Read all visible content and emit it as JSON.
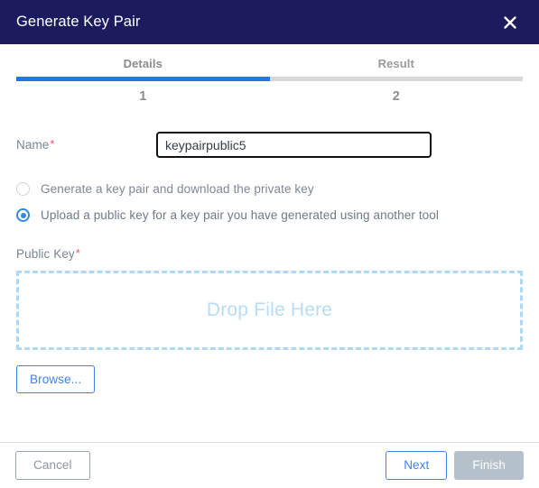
{
  "dialog": {
    "title": "Generate Key Pair",
    "close_icon": "close-icon"
  },
  "stepper": {
    "steps": [
      {
        "label": "Details",
        "number": "1",
        "active": true
      },
      {
        "label": "Result",
        "number": "2",
        "active": false
      }
    ]
  },
  "form": {
    "name_label": "Name",
    "name_required_mark": "*",
    "name_value": "keypairpublic5",
    "name_placeholder": "",
    "options": [
      {
        "label": "Generate a key pair and download the private key",
        "selected": false
      },
      {
        "label": "Upload a public key for a key pair you have generated using another tool",
        "selected": true
      }
    ],
    "public_key_label": "Public Key",
    "public_key_required_mark": "*",
    "dropzone_text": "Drop File Here",
    "browse_label": "Browse..."
  },
  "footer": {
    "cancel_label": "Cancel",
    "next_label": "Next",
    "finish_label": "Finish"
  },
  "colors": {
    "header_bg": "#1b1b5e",
    "accent_blue": "#2673f0",
    "link_blue": "#3e82ea",
    "radio_blue": "#3387e8",
    "required_red": "#e8546a",
    "dropzone_border": "#aed9f4",
    "dropzone_text": "#b6dcf7",
    "disabled_bg": "#b4c0ca",
    "label_gray": "#798595",
    "step_inactive": "#d8d8d8"
  }
}
